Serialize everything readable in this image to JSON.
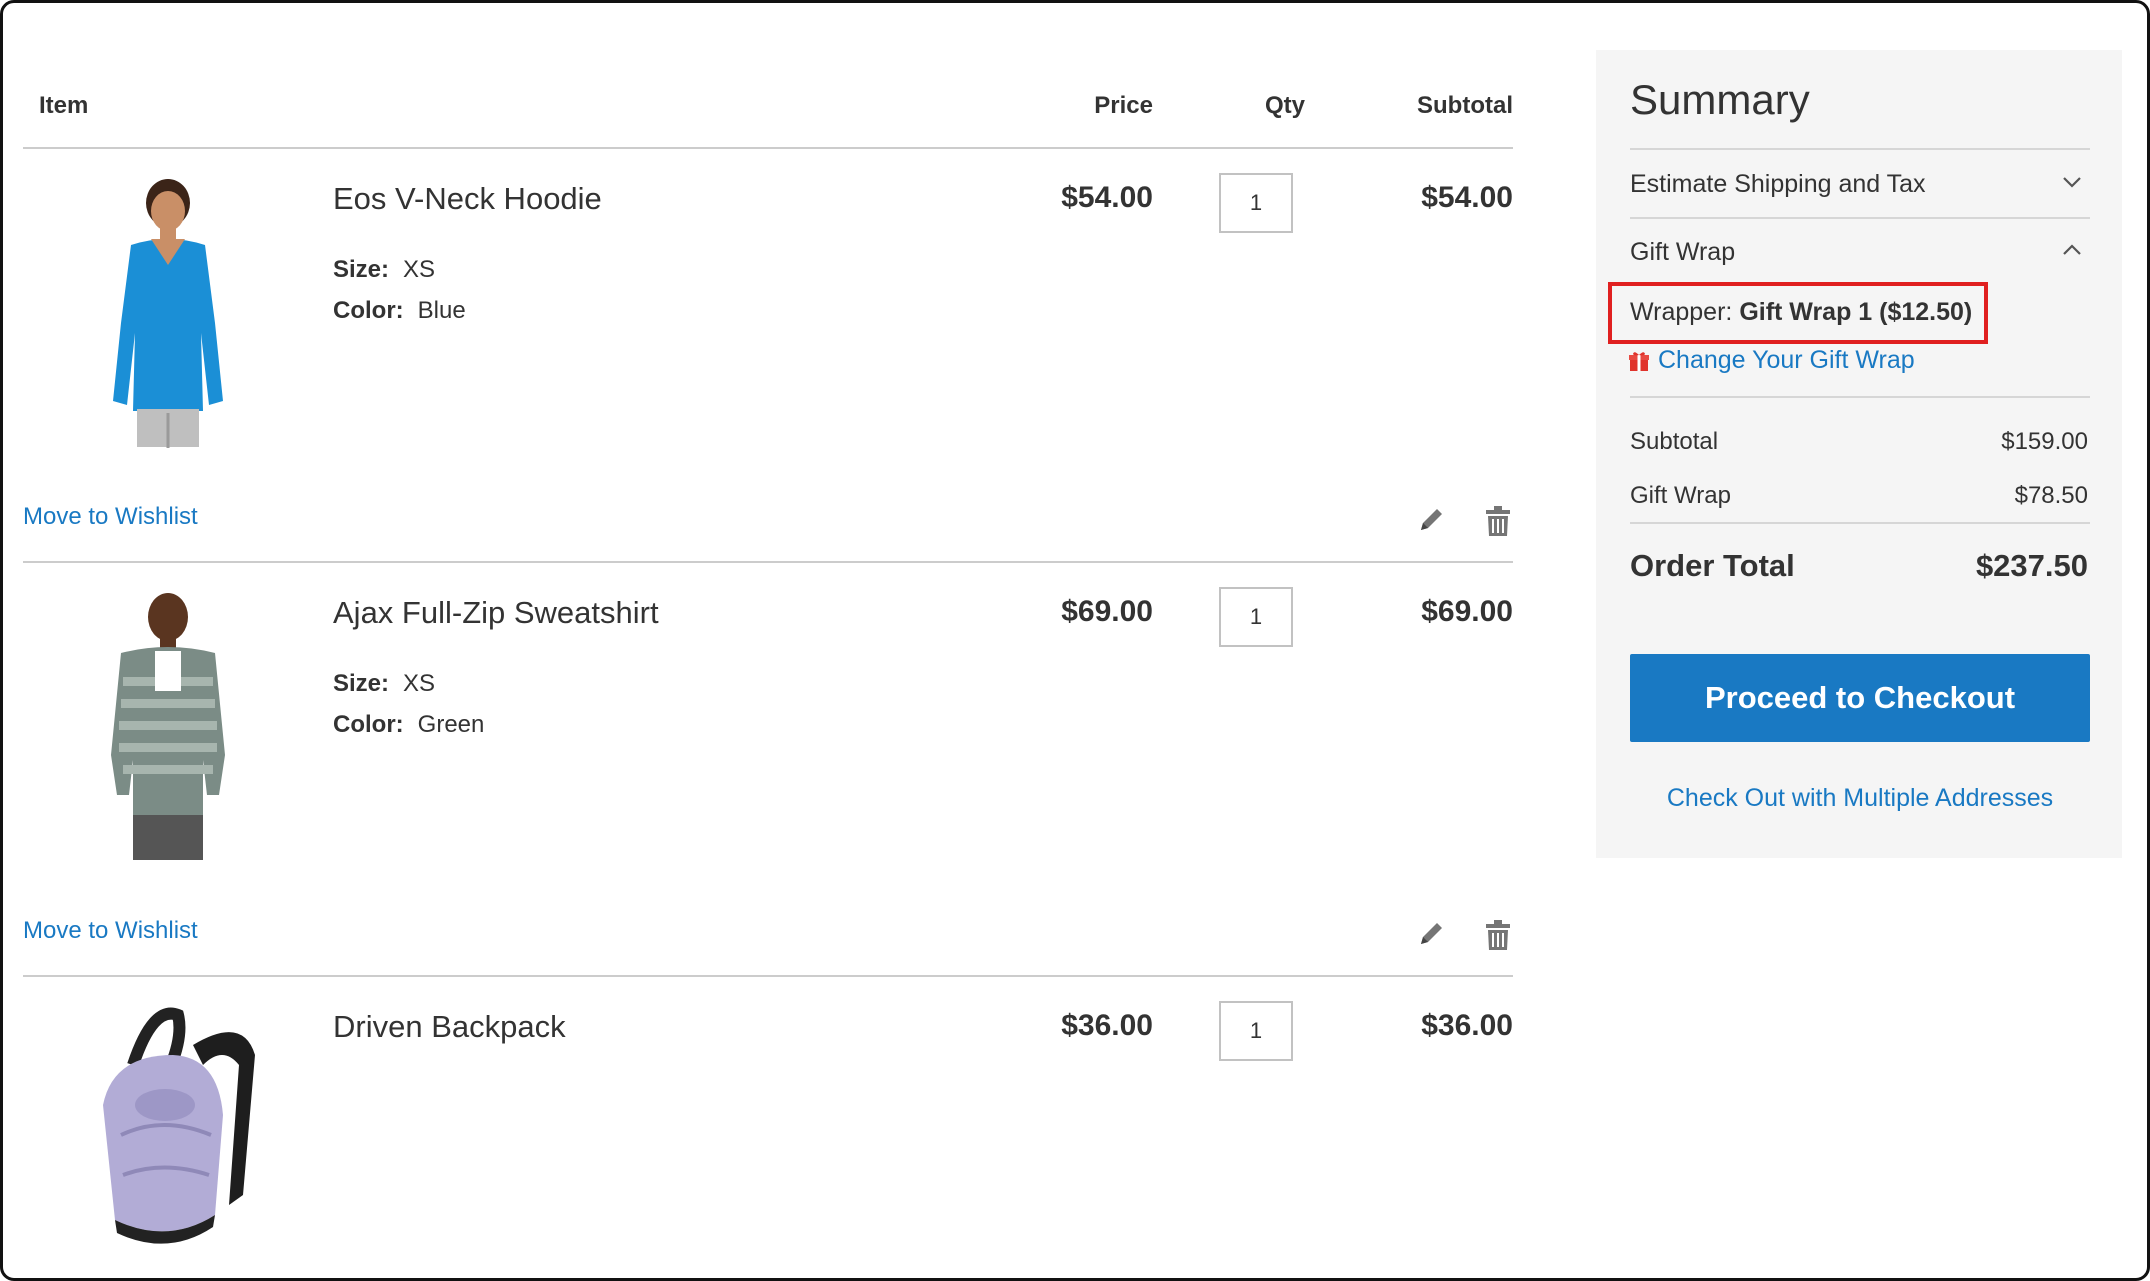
{
  "cart": {
    "headers": {
      "item": "Item",
      "price": "Price",
      "qty": "Qty",
      "subtotal": "Subtotal"
    },
    "items": [
      {
        "name": "Eos V-Neck Hoodie",
        "options": [
          {
            "label": "Size:",
            "value": "XS"
          },
          {
            "label": "Color:",
            "value": "Blue"
          }
        ],
        "price": "$54.00",
        "qty": "1",
        "subtotal": "$54.00",
        "wishlist": "Move to Wishlist",
        "image": "blue-hoodie-woman"
      },
      {
        "name": "Ajax Full-Zip Sweatshirt",
        "options": [
          {
            "label": "Size:",
            "value": "XS"
          },
          {
            "label": "Color:",
            "value": "Green"
          }
        ],
        "price": "$69.00",
        "qty": "1",
        "subtotal": "$69.00",
        "wishlist": "Move to Wishlist",
        "image": "striped-sweatshirt-man"
      },
      {
        "name": "Driven Backpack",
        "options": [],
        "price": "$36.00",
        "qty": "1",
        "subtotal": "$36.00",
        "image": "lavender-backpack"
      }
    ],
    "icons": {
      "edit": "pencil-icon",
      "delete": "trash-icon"
    }
  },
  "summary": {
    "title": "Summary",
    "shipping_label": "Estimate Shipping and Tax",
    "gift_wrap_label": "Gift Wrap",
    "wrapper_label": "Wrapper:",
    "wrapper_value": "Gift Wrap 1 ($12.50)",
    "change_gift_wrap": "Change Your Gift Wrap",
    "totals": [
      {
        "label": "Subtotal",
        "value": "$159.00"
      },
      {
        "label": "Gift Wrap",
        "value": "$78.50"
      }
    ],
    "order_total_label": "Order Total",
    "order_total_value": "$237.50",
    "checkout_button": "Proceed to Checkout",
    "multi_address_link": "Check Out with Multiple Addresses"
  },
  "colors": {
    "link": "#1979c3",
    "button": "#1979c3",
    "highlight": "#e02020",
    "summary_bg": "#f5f5f5"
  }
}
